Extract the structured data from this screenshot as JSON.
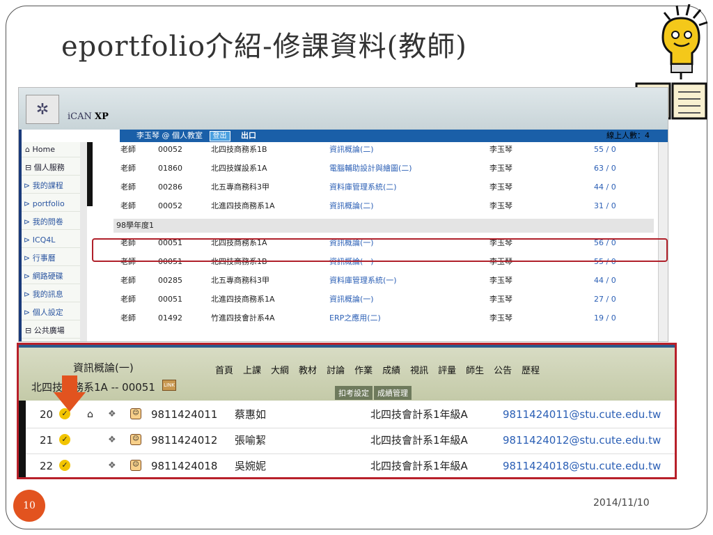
{
  "slide": {
    "title": "eportfolio介紹-修課資料(教師)",
    "page_number": "10",
    "date": "2014/11/10"
  },
  "top_screen": {
    "brand": "iCAN",
    "brand_suffix": "XP",
    "user_label": "李玉琴 @ 個人教室",
    "logout_label": "登出",
    "exit_label": "出口",
    "online_label": "線上人數：4",
    "sidebar": [
      "Home",
      "個人服務",
      "我的課程",
      "portfolio",
      "我的問卷",
      "ICQ4L",
      "行事曆",
      "網路硬碟",
      "我的訊息",
      "個人設定",
      "公共廣場"
    ],
    "courses_before": [
      {
        "role": "老師",
        "id": "00052",
        "cls": "北四技商務系1B",
        "name": "資訊概論(二)",
        "teacher": "李玉琴",
        "count": "55 / 0"
      },
      {
        "role": "老師",
        "id": "01860",
        "cls": "北四技媒設系1A",
        "name": "電腦輔助設計與繪圖(二)",
        "teacher": "李玉琴",
        "count": "63 / 0"
      },
      {
        "role": "老師",
        "id": "00286",
        "cls": "北五專商務科3甲",
        "name": "資料庫管理系統(二)",
        "teacher": "李玉琴",
        "count": "44 / 0"
      },
      {
        "role": "老師",
        "id": "00052",
        "cls": "北進四技商務系1A",
        "name": "資訊概論(二)",
        "teacher": "李玉琴",
        "count": "31 / 0"
      }
    ],
    "group_label": "98學年度1",
    "courses_after": [
      {
        "role": "老師",
        "id": "00051",
        "cls": "北四技商務系1A",
        "name": "資訊概論(一)",
        "teacher": "李玉琴",
        "count": "56 / 0"
      },
      {
        "role": "老師",
        "id": "00051",
        "cls": "北四技商務系1B",
        "name": "資訊概論(一)",
        "teacher": "李玉琴",
        "count": "55 / 0"
      },
      {
        "role": "老師",
        "id": "00285",
        "cls": "北五專商務科3甲",
        "name": "資料庫管理系統(一)",
        "teacher": "李玉琴",
        "count": "44 / 0"
      },
      {
        "role": "老師",
        "id": "00051",
        "cls": "北進四技商務系1A",
        "name": "資訊概論(一)",
        "teacher": "李玉琴",
        "count": "27 / 0"
      },
      {
        "role": "老師",
        "id": "01492",
        "cls": "竹進四技會計系4A",
        "name": "ERP之應用(二)",
        "teacher": "李玉琴",
        "count": "19 / 0"
      }
    ]
  },
  "bottom_screen": {
    "course_title": "資訊概論(一)",
    "course_info": "北四技商務系1A -- 00051",
    "link_icon": "LINK",
    "menu": [
      "首頁",
      "上課",
      "大綱",
      "教材",
      "討論",
      "作業",
      "成績",
      "視訊",
      "評量",
      "師生",
      "公告",
      "歷程"
    ],
    "submenu": [
      "扣考設定",
      "成績管理"
    ],
    "students": [
      {
        "no": "20",
        "sid": "9811424011",
        "name": "蔡惠如",
        "dept": "北四技會計系1年級A",
        "email": "9811424011@stu.cute.edu.tw"
      },
      {
        "no": "21",
        "sid": "9811424012",
        "name": "張喻絜",
        "dept": "北四技會計系1年級A",
        "email": "9811424012@stu.cute.edu.tw"
      },
      {
        "no": "22",
        "sid": "9811424018",
        "name": "吳婉妮",
        "dept": "北四技會計系1年級A",
        "email": "9811424018@stu.cute.edu.tw"
      }
    ]
  },
  "colors": {
    "highlight": "#b0202a",
    "arrow": "#e2531f",
    "link_text": "#2b5fb5",
    "page_badge": "#e2531f"
  }
}
